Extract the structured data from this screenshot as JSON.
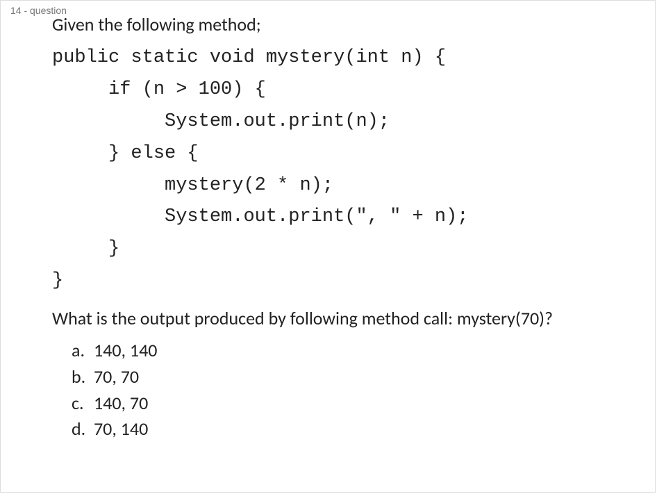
{
  "question_number": "14 -  question",
  "prompt": "Given the following method;",
  "code": "public static void mystery(int n) {\n     if (n > 100) {\n          System.out.print(n);\n     } else {\n          mystery(2 * n);\n          System.out.print(\", \" + n);\n     }\n}",
  "question": "What is the output produced by following method call: mystery(70)?",
  "options": [
    {
      "letter": "a.",
      "text": "140, 140"
    },
    {
      "letter": "b.",
      "text": "70, 70"
    },
    {
      "letter": "c.",
      "text": "140, 70"
    },
    {
      "letter": "d.",
      "text": "70, 140"
    }
  ]
}
